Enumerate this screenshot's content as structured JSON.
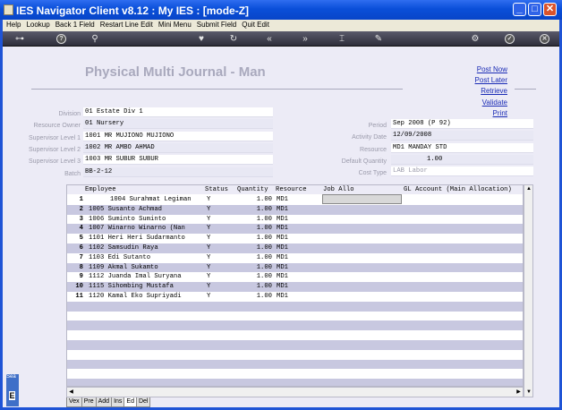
{
  "window": {
    "title": "IES Navigator Client v8.12 : My IES :      [mode-Z]"
  },
  "menu": [
    "Help",
    "Lookup",
    "Back 1 Field",
    "Restart Line Edit",
    "Mini Menu",
    "Submit Field",
    "Quit Edit"
  ],
  "page": {
    "title": "Physical Multi Journal - Man"
  },
  "links": [
    "Post Now",
    "Post Later",
    "Retrieve",
    "Validate",
    "Print"
  ],
  "left_fields": [
    {
      "label": "Division",
      "value": "01 Estate Div 1"
    },
    {
      "label": "Resource Owner",
      "value": "01 Nursery"
    },
    {
      "label": "Supervisor Level 1",
      "value": "1001 MR MUJIONO MUJIONO"
    },
    {
      "label": "Supervisor Level 2",
      "value": "1002 MR AMBO AHMAD"
    },
    {
      "label": "Supervisor Level 3",
      "value": "1003 MR SUBUR SUBUR"
    },
    {
      "label": "Batch",
      "value": "BB-2-12"
    }
  ],
  "right_fields": [
    {
      "label": "Period",
      "value": "Sep 2008 (P 92)"
    },
    {
      "label": "Activity Date",
      "value": "12/09/2008"
    },
    {
      "label": "Resource",
      "value": "MD1 MANDAY STD"
    },
    {
      "label": "Default Quantity",
      "value": "1.00"
    },
    {
      "label": "Cost Type",
      "value": "LAB Labor"
    }
  ],
  "grid": {
    "columns": [
      "Employee",
      "Status",
      "Quantity",
      "Resource",
      "Job Allo",
      "GL Account (Main Allocation)"
    ],
    "rows": [
      {
        "num": "1",
        "employee": "1004 Surahmat Legiman",
        "status": "Y",
        "quantity": "1.00",
        "resource": "MD1"
      },
      {
        "num": "2",
        "employee": "1005 Susanto Achmad",
        "status": "Y",
        "quantity": "1.00",
        "resource": "MD1"
      },
      {
        "num": "3",
        "employee": "1006 Suminto Suminto",
        "status": "Y",
        "quantity": "1.00",
        "resource": "MD1"
      },
      {
        "num": "4",
        "employee": "1007 Winarno Winarno (Nan",
        "status": "Y",
        "quantity": "1.00",
        "resource": "MD1"
      },
      {
        "num": "5",
        "employee": "1101 Heri Heri Sudarmanto",
        "status": "Y",
        "quantity": "1.00",
        "resource": "MD1"
      },
      {
        "num": "6",
        "employee": "1102 Samsudin Raya",
        "status": "Y",
        "quantity": "1.00",
        "resource": "MD1"
      },
      {
        "num": "7",
        "employee": "1103 Edi Sutanto",
        "status": "Y",
        "quantity": "1.00",
        "resource": "MD1"
      },
      {
        "num": "8",
        "employee": "1109 Akmal Sukamto",
        "status": "Y",
        "quantity": "1.00",
        "resource": "MD1"
      },
      {
        "num": "9",
        "employee": "1112 Juanda Imal Suryana",
        "status": "Y",
        "quantity": "1.00",
        "resource": "MD1"
      },
      {
        "num": "10",
        "employee": "1115 Sihombing Mustafa",
        "status": "Y",
        "quantity": "1.00",
        "resource": "MD1"
      },
      {
        "num": "11",
        "employee": "1120 Kamal Eko Supriyadi",
        "status": "Y",
        "quantity": "1.00",
        "resource": "MD1"
      }
    ]
  },
  "tabs": [
    "Vex",
    "Pre",
    "Add",
    "Ins",
    "Ed",
    "Del"
  ],
  "active_tab": "Ed",
  "side_strip": {
    "text": "Sea"
  }
}
